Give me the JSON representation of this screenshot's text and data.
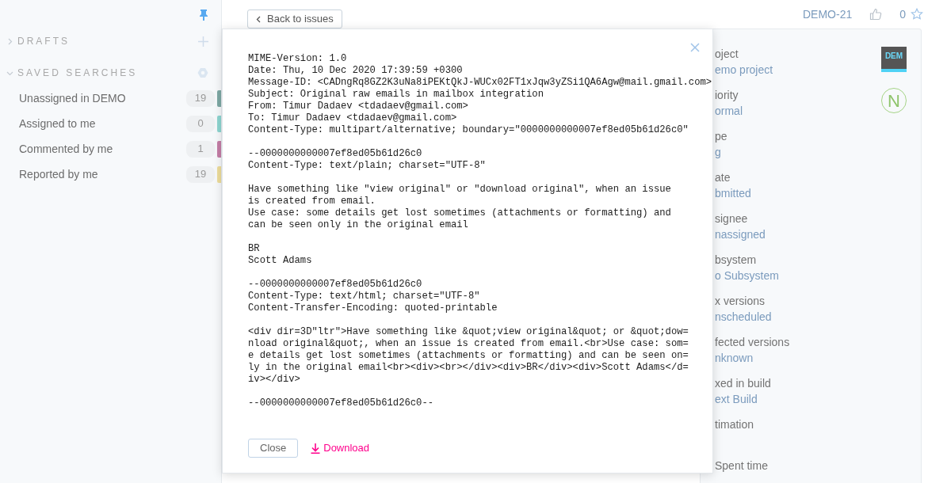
{
  "sidebar": {
    "sections": [
      {
        "title": "DRAFTS",
        "expanded": false
      },
      {
        "title": "SAVED SEARCHES",
        "expanded": true,
        "items": [
          {
            "label": "Unassigned in DEMO",
            "count": "19",
            "color": "#7ea9a5"
          },
          {
            "label": "Assigned to me",
            "count": "0",
            "color": "#8ed6d1"
          },
          {
            "label": "Commented by me",
            "count": "1",
            "color": "#c57ea7"
          },
          {
            "label": "Reported by me",
            "count": "19",
            "color": "#eedd9b"
          }
        ]
      }
    ]
  },
  "back_button": "Back to issues",
  "issue": {
    "id": "DEMO-21",
    "votes": "0",
    "starred": false
  },
  "fields": [
    {
      "label": "oject",
      "value": "emo project",
      "badge": "DEM"
    },
    {
      "label": "iority",
      "value": "ormal",
      "badge": "N"
    },
    {
      "label": "pe",
      "value": "g"
    },
    {
      "label": "ate",
      "value": "bmitted"
    },
    {
      "label": "signee",
      "value": "nassigned"
    },
    {
      "label": "bsystem",
      "value": "o Subsystem"
    },
    {
      "label": "x versions",
      "value": "nscheduled"
    },
    {
      "label": "fected versions",
      "value": "nknown"
    },
    {
      "label": "xed in build",
      "value": "ext Build"
    },
    {
      "label": "timation"
    },
    {
      "label": "Spent time"
    }
  ],
  "dialog": {
    "blocks": [
      [
        "MIME-Version: 1.0",
        "Date: Thu, 10 Dec 2020 17:39:59 +0300",
        "Message-ID: <CADngRq8GZ2K3uNa8iPEKtQkJ-WUCx02FT1xJqw3yZSi1QA6Agw@mail.gmail.com>",
        "Subject: Original raw emails in mailbox integration",
        "From: Timur Dadaev <tdadaev@gmail.com>",
        "To: Timur Dadaev <tdadaev@gmail.com>",
        "Content-Type: multipart/alternative; boundary=\"0000000000007ef8ed05b61d26c0\""
      ],
      [
        "--0000000000007ef8ed05b61d26c0",
        "Content-Type: text/plain; charset=\"UTF-8\""
      ],
      [
        "Have something like \"view original\" or \"download original\", when an issue",
        "is created from email.",
        "Use case: some details get lost sometimes (attachments or formatting) and",
        "can be seen only in the original email"
      ],
      [
        "BR",
        "Scott Adams"
      ],
      [
        "--0000000000007ef8ed05b61d26c0",
        "Content-Type: text/html; charset=\"UTF-8\"",
        "Content-Transfer-Encoding: quoted-printable"
      ],
      [
        "<div dir=3D\"ltr\">Have something like &quot;view original&quot; or &quot;dow=",
        "nload original&quot;, when an issue is created from email.<br>Use case: som=",
        "e details get lost sometimes (attachments or formatting) and can be seen on=",
        "ly in the original email<br><div><br></div><div>BR</div><div>Scott Adams</d=",
        "iv></div>"
      ],
      [
        "--0000000000007ef8ed05b61d26c0--"
      ]
    ],
    "close_button": "Close",
    "download_link": "Download"
  }
}
